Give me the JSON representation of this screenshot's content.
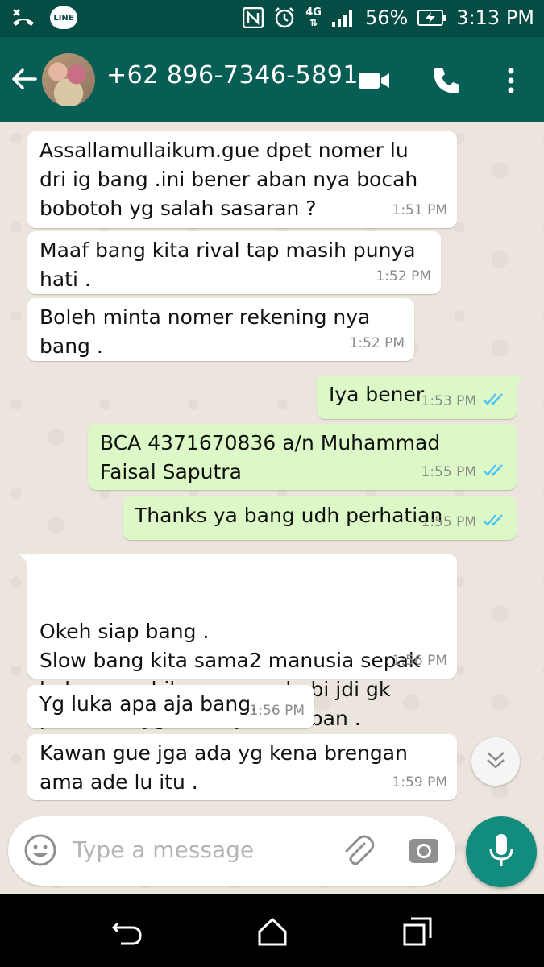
{
  "status_bar": {
    "network": "4G",
    "battery": "56%",
    "time": "3:13 PM",
    "line_app": "LINE",
    "icons": [
      "missed-call-icon",
      "line-app-icon",
      "nfc-icon",
      "alarm-icon",
      "4g-icon",
      "signal-icon",
      "battery-charging-icon"
    ]
  },
  "header": {
    "contact": "+62 896-7346-5891",
    "icons": [
      "back-arrow-icon",
      "video-call-icon",
      "voice-call-icon",
      "more-options-icon"
    ]
  },
  "messages": [
    {
      "direction": "in",
      "text": "Assallamullaikum.gue dpet nomer lu dri ig bang .ini bener aban nya bocah bobotoh yg salah sasaran ?",
      "time": "1:51 PM"
    },
    {
      "direction": "in",
      "text": "Maaf bang kita rival tap masih punya hati .",
      "time": "1:52 PM"
    },
    {
      "direction": "in",
      "text": "Boleh minta nomer rekening nya bang .",
      "time": "1:52 PM"
    },
    {
      "direction": "out",
      "text": "Iya bener",
      "time": "1:53 PM",
      "status": "read"
    },
    {
      "direction": "out",
      "text": "BCA 4371670836 a/n Muhammad Faisal Saputra",
      "time": "1:55 PM",
      "status": "read"
    },
    {
      "direction": "out",
      "text": "Thanks ya bang udh perhatian",
      "time": "1:55 PM",
      "status": "read"
    },
    {
      "direction": "in",
      "text": "Okeh siap bang .\nSlow bang kita sama2 manusia sepak bola cuma hiburan ama hobi jdi gk perlu ada yg harus jadi korban .",
      "time": "1:56 PM"
    },
    {
      "direction": "in",
      "text": "Yg luka apa aja bang.",
      "time": "1:56 PM"
    },
    {
      "direction": "in",
      "text": "Kawan gue jga ada yg kena brengan ama ade lu itu .",
      "time": "1:59 PM"
    }
  ],
  "composer": {
    "placeholder": "Type a message",
    "icons": [
      "emoji-icon",
      "attach-icon",
      "camera-icon",
      "mic-icon"
    ]
  },
  "colors": {
    "status_bar": "#054d44",
    "header": "#075e54",
    "incoming_bubble": "#ffffff",
    "outgoing_bubble": "#dcf8c6",
    "mic_button": "#128c7e",
    "read_ticks": "#4fc3f7"
  }
}
